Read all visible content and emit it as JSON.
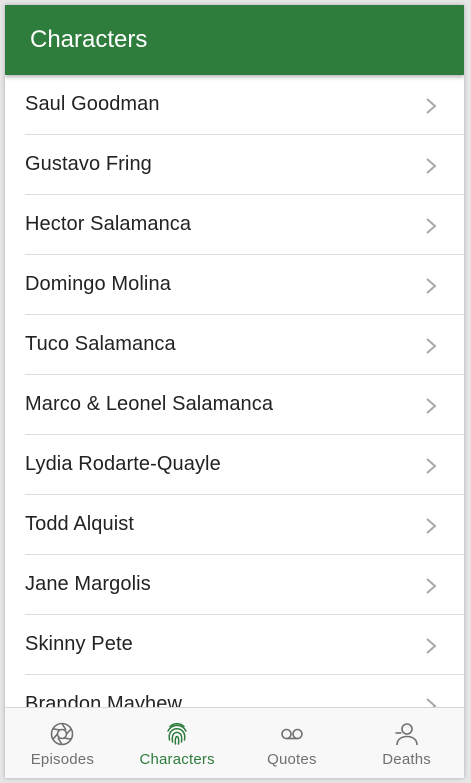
{
  "header": {
    "title": "Characters"
  },
  "characters": [
    "Saul Goodman",
    "Gustavo Fring",
    "Hector Salamanca",
    "Domingo Molina",
    "Tuco Salamanca",
    "Marco & Leonel Salamanca",
    "Lydia Rodarte-Quayle",
    "Todd Alquist",
    "Jane Margolis",
    "Skinny Pete",
    "Brandon Mayhew"
  ],
  "tabs": [
    {
      "label": "Episodes",
      "icon": "aperture-icon",
      "active": false
    },
    {
      "label": "Characters",
      "icon": "fingerprint-icon",
      "active": true
    },
    {
      "label": "Quotes",
      "icon": "voicemail-icon",
      "active": false
    },
    {
      "label": "Deaths",
      "icon": "person-minus-icon",
      "active": false
    }
  ],
  "colors": {
    "primary": "#2e7d3c",
    "inactive_tab": "#707070",
    "divider": "#dcdcdc"
  }
}
